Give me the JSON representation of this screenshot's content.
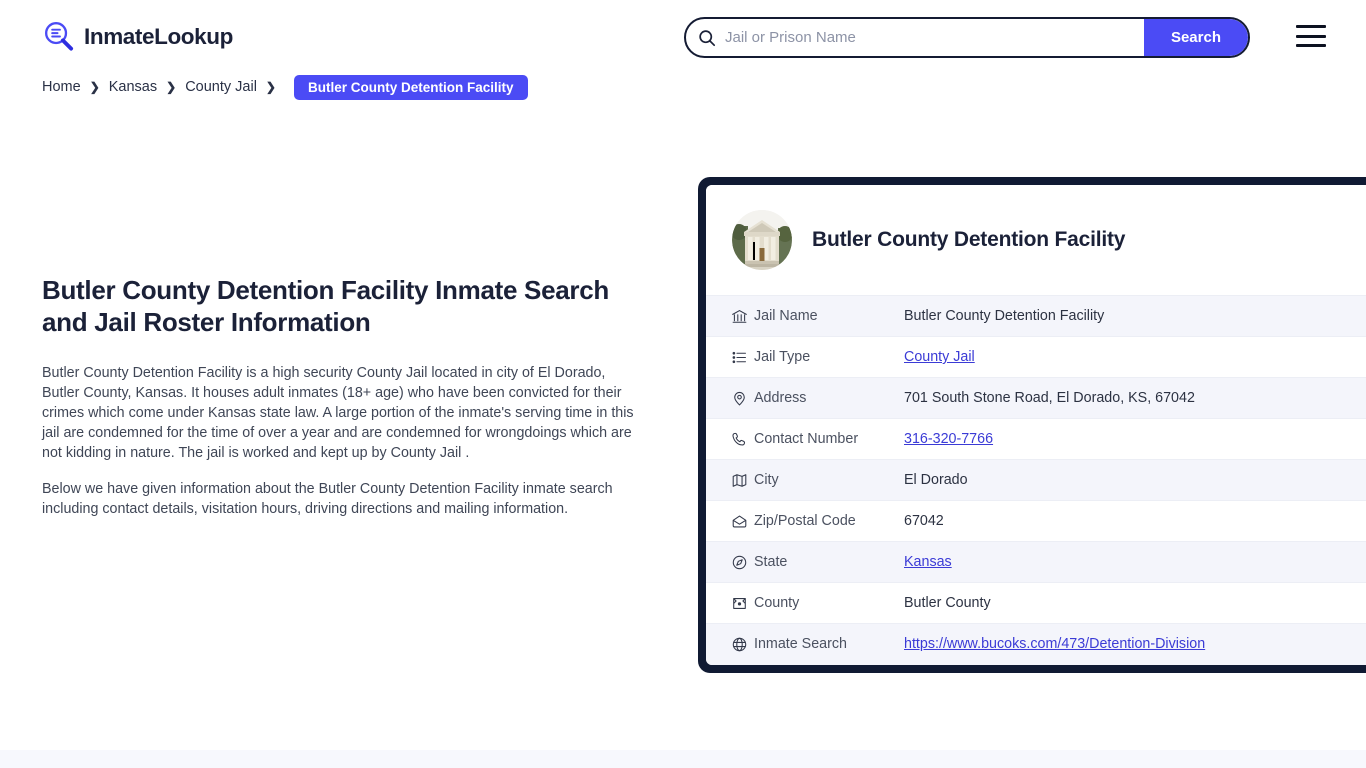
{
  "header": {
    "logo": {
      "text": "InmateLookup",
      "icon": "magnifier-list-icon"
    },
    "search": {
      "placeholder": "Jail or Prison Name",
      "value": "",
      "button_label": "Search",
      "icon": "search-icon"
    },
    "menu": {
      "icon": "hamburger-menu-icon"
    }
  },
  "breadcrumb": {
    "items": [
      {
        "label": "Home"
      },
      {
        "label": "Kansas"
      },
      {
        "label": "County Jail"
      }
    ],
    "separator": "❯",
    "current": "Butler County Detention Facility"
  },
  "main": {
    "title": "Butler County Detention Facility Inmate Search and Jail Roster Information",
    "paragraphs": [
      "Butler County Detention Facility is a high security County Jail located in city of El Dorado, Butler County, Kansas. It houses adult inmates (18+ age) who have been convicted for their crimes which come under Kansas state law. A large portion of the inmate's serving time in this jail are condemned for the time of over a year and are condemned for wrongdoings which are not kidding in nature. The jail is worked and kept up by County Jail .",
      "Below we have given information about the Butler County Detention Facility inmate search including contact details, visitation hours, driving directions and mailing information."
    ]
  },
  "card": {
    "avatar_icon": "courthouse-photo",
    "title": "Butler County Detention Facility",
    "rows": [
      {
        "icon": "bank-icon",
        "label": "Jail Name",
        "value": "Butler County Detention Facility",
        "link": false
      },
      {
        "icon": "list-icon",
        "label": "Jail Type",
        "value": "County Jail",
        "link": true
      },
      {
        "icon": "map-pin-icon",
        "label": "Address",
        "value": "701 South Stone Road, El Dorado, KS, 67042",
        "link": false
      },
      {
        "icon": "phone-icon",
        "label": "Contact Number",
        "value": "316-320-7766",
        "link": true
      },
      {
        "icon": "map-icon",
        "label": "City",
        "value": "El Dorado",
        "link": false
      },
      {
        "icon": "mail-open-icon",
        "label": "Zip/Postal Code",
        "value": "67042",
        "link": false
      },
      {
        "icon": "compass-icon",
        "label": "State",
        "value": "Kansas",
        "link": true
      },
      {
        "icon": "county-icon",
        "label": "County",
        "value": "Butler County",
        "link": false
      },
      {
        "icon": "globe-icon",
        "label": "Inmate Search",
        "value": "https://www.bucoks.com/473/Detention-Division",
        "link": true
      }
    ]
  },
  "colors": {
    "accent": "#4b4bf5",
    "link": "#3b3bd6",
    "card_border": "#101a33",
    "row_stripe": "#f4f5fb",
    "text_dark": "#1b2138"
  }
}
